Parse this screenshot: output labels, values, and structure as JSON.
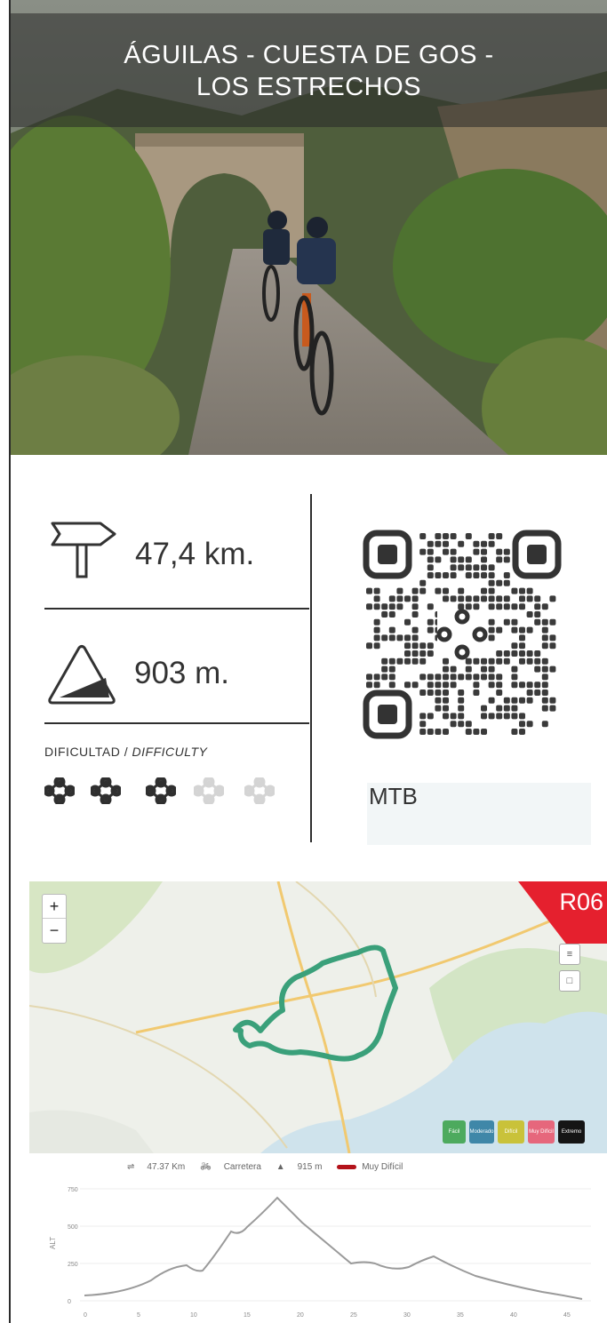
{
  "route": {
    "title_line1": "ÁGUILAS - CUESTA DE GOS -",
    "title_line2": "LOS ESTRECHOS",
    "distance": "47,4 km.",
    "elevation": "903 m.",
    "difficulty_label": "DIFICULTAD / ",
    "difficulty_label_en": "DIFFICULTY",
    "difficulty_level": 3,
    "difficulty_max": 5,
    "type": "MTB",
    "code": "R06"
  },
  "icons": {
    "distance": "signpost-icon",
    "elevation": "slope-icon",
    "difficulty": "chain-link-icon"
  },
  "map": {
    "zoom_in": "+",
    "zoom_out": "−",
    "legend": [
      {
        "label": "Fácil",
        "color": "#4daa5e"
      },
      {
        "label": "Moderado",
        "color": "#3f87a8"
      },
      {
        "label": "Difícil",
        "color": "#c9c23a"
      },
      {
        "label": "Muy Difícil",
        "color": "#e6677c"
      },
      {
        "label": "Extremo",
        "color": "#151515"
      }
    ],
    "route_color": "#3aa07a",
    "tag_color": "#e5202e"
  },
  "elevation_profile": {
    "distance": "47.37 Km",
    "surface": "Carretera",
    "max_altitude": "915 m",
    "difficulty": "Muy Difícil",
    "difficulty_color": "#b3121a",
    "y_ticks": [
      "750",
      "500",
      "250",
      "0"
    ],
    "x_ticks": [
      "0",
      "5",
      "10",
      "15",
      "20",
      "25",
      "30",
      "35",
      "40",
      "45"
    ]
  }
}
